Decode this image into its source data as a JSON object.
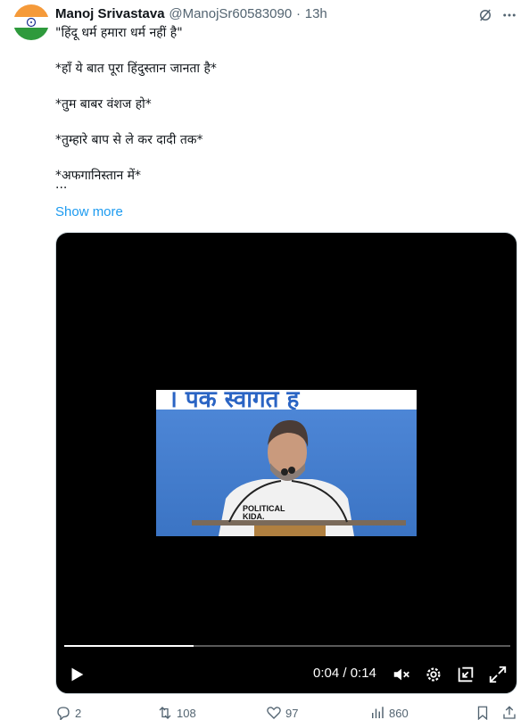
{
  "author": {
    "name": "Manoj Srivastava",
    "handle": "@ManojSr60583090",
    "separator": "·",
    "time": "13h",
    "avatar_icon": "india-flag-avatar"
  },
  "tweet": {
    "lines": [
      "\"हिंदू धर्म हमारा धर्म नहीं है\"",
      "*हाँ ये बात पूरा हिंदुस्तान जानता है*",
      "*तुम बाबर वंशज हो*",
      "*तुम्हारे बाप से ले कर दादी तक*",
      "*अफगानिस्तान में*"
    ],
    "truncated_line": "...",
    "show_more": "Show more"
  },
  "video": {
    "banner_text": "। पक स्वागत ह",
    "watermark_line1": "POLITICAL",
    "watermark_line2": "KIDA.",
    "current_time": "0:04",
    "duration": "0:14",
    "time_display": "0:04 / 0:14",
    "progress": 0.29
  },
  "actions": {
    "replies": "2",
    "reposts": "108",
    "likes": "97",
    "views": "860"
  },
  "colors": {
    "accent": "#1d9bf0",
    "secondary_text": "#536471",
    "video_bg": "#000000"
  }
}
